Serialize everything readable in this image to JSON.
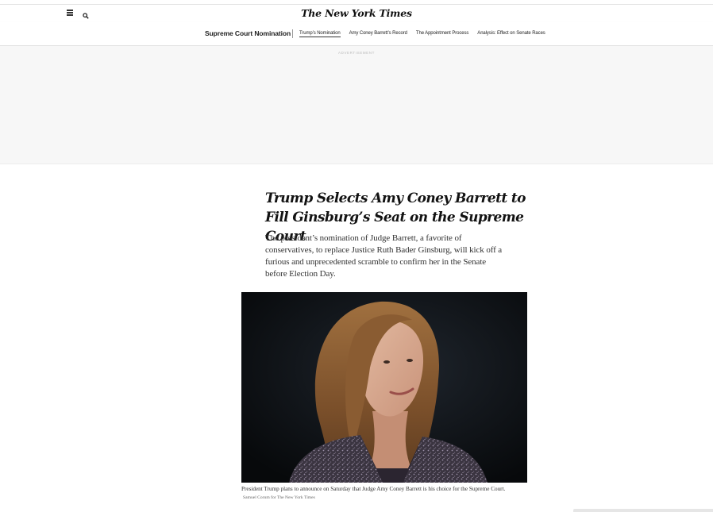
{
  "masthead": {
    "logo_text": "The New York Times",
    "menu_icon": "hamburger-menu-icon",
    "search_icon": "search-icon"
  },
  "subnav": {
    "section_title": "Supreme Court Nomination",
    "links": [
      {
        "label": "Trump’s Nomination",
        "active": true
      },
      {
        "label": "Amy Coney Barrett’s Record",
        "active": false
      },
      {
        "label": "The Appointment Process",
        "active": false
      },
      {
        "label": "Analysis: Effect on Senate Races",
        "active": false
      }
    ]
  },
  "ad": {
    "label": "ADVERTISEMENT"
  },
  "article": {
    "headline": "Trump Selects Amy Coney Barrett to Fill Ginsburg’s Seat on the Supreme Court",
    "summary": "The president’s nomination of Judge Barrett, a favorite of conservatives, to replace Justice Ruth Bader Ginsburg, will kick off a furious and unprecedented scramble to confirm her in the Senate before Election Day.",
    "caption": "President Trump plans to announce on Saturday that Judge Amy Coney Barrett is his choice for the Supreme Court.",
    "credit": "Samuel Corum for The New York Times"
  },
  "colors": {
    "text": "#121212",
    "ad_background": "#f7f7f7",
    "photo_background": "#0b0d10"
  }
}
